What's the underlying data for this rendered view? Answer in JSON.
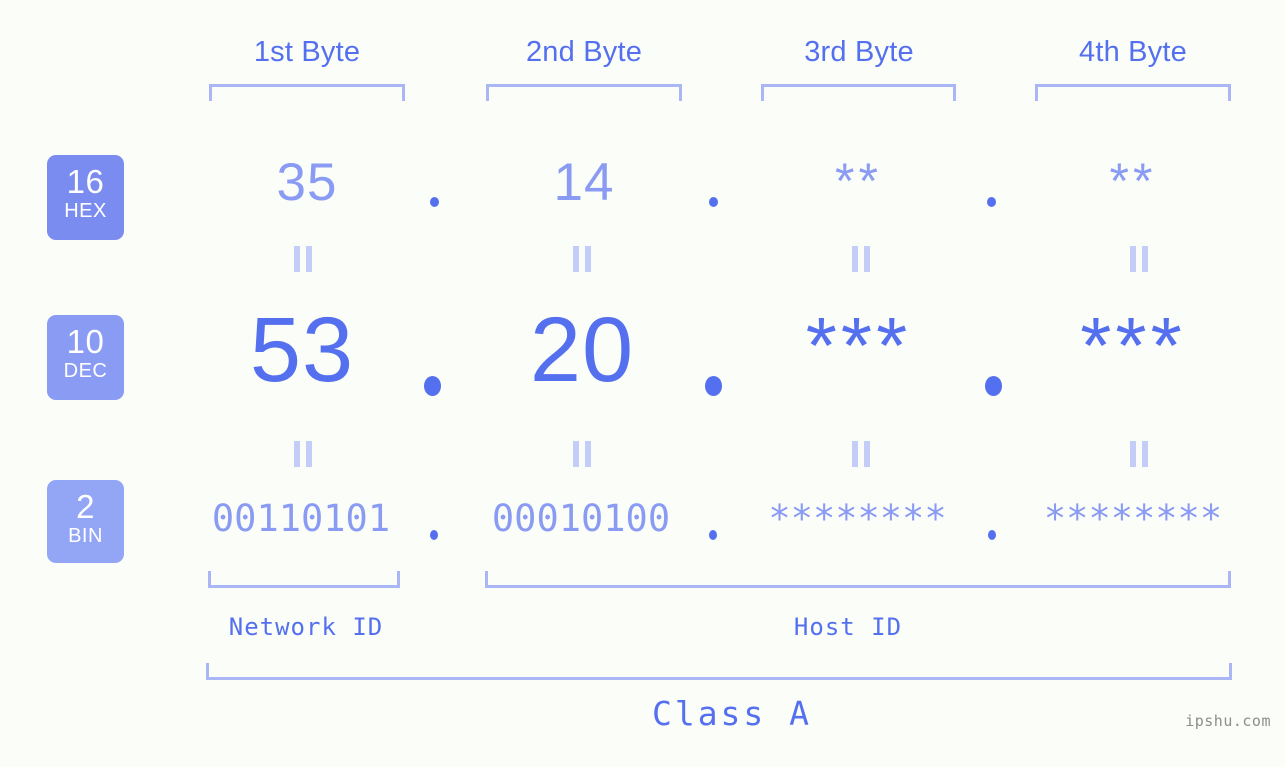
{
  "meta": {
    "background": "#fbfdf8",
    "accent_strong": "#5570ef",
    "accent_mid": "#8a9bf3",
    "accent_light": "#aab6f5",
    "bracket_color": "#aab6f5",
    "watermark": "ipshu.com"
  },
  "byte_headers": [
    {
      "label": "1st Byte"
    },
    {
      "label": "2nd Byte"
    },
    {
      "label": "3rd Byte"
    },
    {
      "label": "4th Byte"
    }
  ],
  "rows": [
    {
      "badge": {
        "base": "16",
        "name": "HEX",
        "color": "#7b8cf0"
      },
      "values": [
        "35",
        "14",
        "**",
        "**"
      ],
      "separator": "."
    },
    {
      "badge": {
        "base": "10",
        "name": "DEC",
        "color": "#8a9bf3"
      },
      "values": [
        "53",
        "20",
        "***",
        "***"
      ],
      "separator": "."
    },
    {
      "badge": {
        "base": "2",
        "name": "BIN",
        "color": "#93a6f6"
      },
      "values": [
        "00110101",
        "00010100",
        "********",
        "********"
      ],
      "separator": "."
    }
  ],
  "equality_marker": "=",
  "id_labels": {
    "network": "Network ID",
    "host": "Host ID"
  },
  "class_label": "Class A"
}
